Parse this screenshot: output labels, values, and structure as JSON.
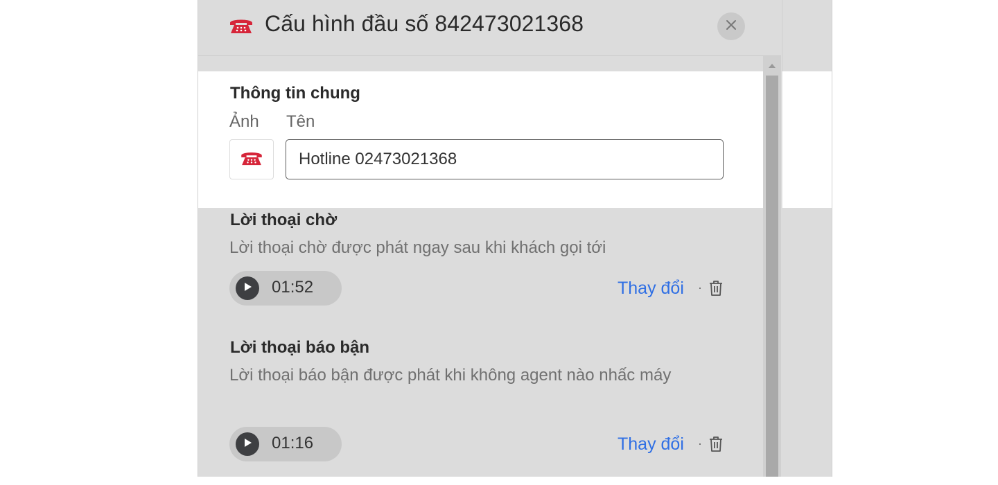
{
  "dialog": {
    "title": "Cấu hình đầu số 842473021368",
    "icon": "red-telephone-icon",
    "accent_color": "#d6263a"
  },
  "general": {
    "heading": "Thông tin chung",
    "avatar_label": "Ảnh",
    "name_label": "Tên",
    "name_value": "Hotline 02473021368"
  },
  "waiting": {
    "heading": "Lời thoại chờ",
    "description": "Lời thoại chờ được phát ngay sau khi khách gọi tới",
    "duration": "01:52",
    "change_label": "Thay đổi",
    "separator": "·"
  },
  "busy": {
    "heading": "Lời thoại báo bận",
    "description": "Lời thoại báo bận được phát khi không agent nào nhấc máy",
    "duration": "01:16",
    "change_label": "Thay đổi",
    "separator": "·"
  },
  "colors": {
    "link": "#2f6fe4",
    "panel_bg": "#dcdcdc",
    "player_bg": "#c8c8c8"
  }
}
